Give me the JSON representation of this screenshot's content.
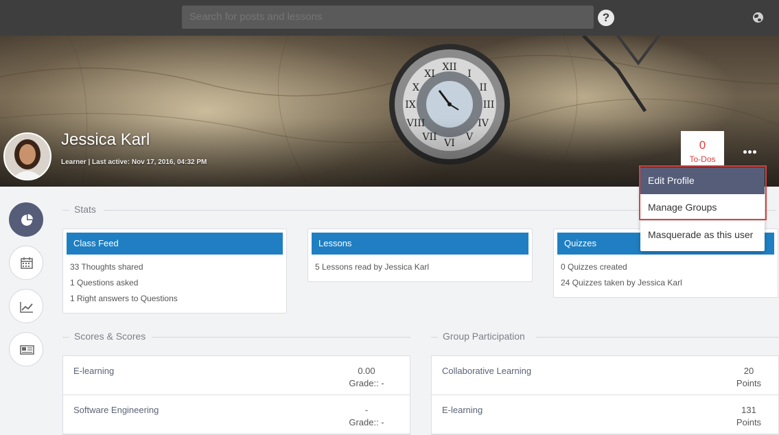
{
  "topbar": {
    "search_placeholder": "Search for posts and lessons",
    "help_icon": "?",
    "icons": [
      "help-icon",
      "globe-icon"
    ]
  },
  "profile": {
    "name": "Jessica Karl",
    "meta": "Learner | Last active: Nov 17, 2016, 04:32 PM",
    "todos_count": "0",
    "todos_label": "To-Dos"
  },
  "menu": {
    "items": [
      "Edit Profile",
      "Manage Groups",
      "Masquerade as this user"
    ]
  },
  "sidebar": {
    "icons": [
      "pie-chart-icon",
      "calendar-icon",
      "trend-chart-icon",
      "newspaper-icon"
    ]
  },
  "stats": {
    "heading": "Stats",
    "cards": [
      {
        "title": "Class Feed",
        "lines": [
          "33 Thoughts shared",
          "1 Questions asked",
          "1 Right answers to Questions"
        ]
      },
      {
        "title": "Lessons",
        "lines": [
          "5 Lessons read by Jessica Karl"
        ]
      },
      {
        "title": "Quizzes",
        "lines": [
          "0 Quizzes created",
          "24 Quizzes taken by Jessica Karl"
        ]
      }
    ]
  },
  "scores": {
    "heading": "Scores & Scores",
    "rows": [
      {
        "name": "E-learning",
        "value": "0.00",
        "sub": "Grade:: -"
      },
      {
        "name": "Software Engineering",
        "value": "-",
        "sub": "Grade:: -"
      }
    ]
  },
  "groups": {
    "heading": "Group Participation",
    "rows": [
      {
        "name": "Collaborative Learning",
        "value": "20",
        "sub": "Points"
      },
      {
        "name": "E-learning",
        "value": "131",
        "sub": "Points"
      }
    ]
  },
  "colors": {
    "topbar": "#3e3e3e",
    "card_header": "#1f7fc2",
    "menu_highlight": "#555d78",
    "todo_red": "#e23b3b",
    "focus_outline": "#d9413c"
  }
}
